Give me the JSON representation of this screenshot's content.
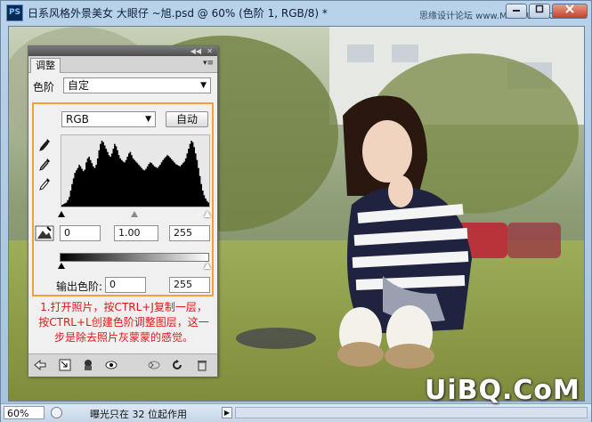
{
  "window": {
    "title": "日系风格外景美女  大眼仔 ~旭.psd @ 60% (色阶 1, RGB/8) *",
    "app_icon": "PS",
    "watermark": "思缘设计论坛 www.MISSYUAN.COM",
    "minimize_icon": "minimize-icon",
    "maximize_icon": "maximize-icon",
    "close_icon": "close-icon"
  },
  "status": {
    "zoom": "60%",
    "info": "曝光只在 32 位起作用",
    "arrow": "▶"
  },
  "brand": "UiBQ.CoM",
  "panel": {
    "tab": "调整",
    "collapse_icon": "◀◀",
    "close_icon": "✕",
    "menu_icon": "▾≡",
    "preset_label": "色阶",
    "preset_value": "自定",
    "channel_value": "RGB",
    "auto_label": "自动",
    "input_black": "0",
    "input_gamma": "1.00",
    "input_white": "255",
    "output_label": "输出色阶:",
    "output_black": "0",
    "output_white": "255",
    "note": "1.打开照片，按CTRL+J复制一层，按CTRL+L创建色阶调整图层，这一步是除去照片灰蒙蒙的感觉。"
  },
  "histogram_levels": [
    2,
    3,
    4,
    5,
    8,
    12,
    20,
    28,
    35,
    42,
    45,
    48,
    52,
    50,
    47,
    44,
    46,
    55,
    60,
    62,
    58,
    54,
    50,
    48,
    52,
    60,
    70,
    78,
    82,
    80,
    76,
    72,
    68,
    64,
    62,
    66,
    72,
    78,
    75,
    70,
    64,
    60,
    58,
    56,
    55,
    58,
    62,
    66,
    68,
    64,
    60,
    58,
    56,
    54,
    52,
    50,
    48,
    46,
    45,
    47,
    50,
    53,
    55,
    54,
    52,
    50,
    49,
    48,
    50,
    52,
    55,
    58,
    60,
    62,
    64,
    63,
    61,
    59,
    57,
    55,
    53,
    52,
    51,
    50,
    52,
    54,
    56,
    60,
    66,
    72,
    78,
    82,
    80,
    74,
    66,
    58,
    48,
    38,
    28,
    20,
    14,
    10,
    7,
    5
  ],
  "colors": {
    "accent": "#f5a033",
    "note": "#e01818"
  }
}
